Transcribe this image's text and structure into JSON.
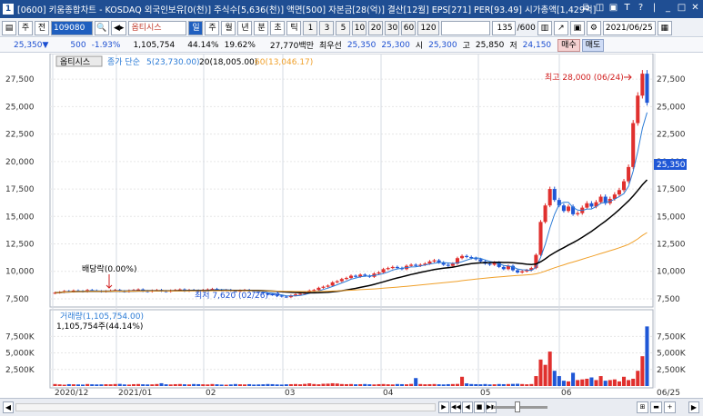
{
  "window": {
    "icon": "1",
    "title": "[0600] 키움종합차트 - KOSDAQ 외국인보유[0(천)] 주식수[5,636(천)] 액면[500] 자본금[28(억)] 결산[12월] EPS[271] PER[93.49] 시가총액[1,429억]",
    "buttons": [
      "⧉",
      "◫",
      "▣",
      "T",
      "?",
      "|",
      "_",
      "□",
      "✕"
    ]
  },
  "toolbar1": {
    "menu_icon": "▤",
    "type_label": "주",
    "all_label": "전",
    "code_value": "109080",
    "search_icon": "🔍",
    "arrow_label": "◀▸",
    "stock_name": "옵티시스",
    "periods": [
      "일",
      "주",
      "월",
      "년",
      "분",
      "초",
      "틱"
    ],
    "active_period": "일",
    "intervals": [
      "1",
      "3",
      "5",
      "10",
      "20",
      "30",
      "60",
      "120"
    ],
    "count_value": "135",
    "count_total": "/600",
    "date_value": "2021/06/25",
    "calendar_icon": "📅"
  },
  "quote": {
    "price": "25,350",
    "direction_icon": "▼",
    "change": "500",
    "change_pct": "-1.93%",
    "volume": "1,105,754",
    "vol_ratio": "44.14%",
    "turnover": "19.62%",
    "amount": "27,770백만",
    "bid_label": "최우선",
    "bid": "25,350",
    "ask": "25,300",
    "open_label": "시",
    "open": "25,300",
    "high_label": "고",
    "high": "25,850",
    "low_label": "저",
    "low": "24,150",
    "buy_label": "매수",
    "sell_label": "매도"
  },
  "chart_legend": {
    "name": "옵티시스",
    "ma_label": "종가 단순",
    "ma5": "5(23,730.00)",
    "ma20": "20(18,005.00)",
    "ma60": "60(13,046.17)",
    "high_label": "최고 28,000 (06/24)",
    "low_label": "최저 7,620 (02/26)",
    "dividend_label": "배당락(0.00%)",
    "volume_label": "거래량(1,105,754.00)",
    "volume_sub": "1,105,754주(44.14%)",
    "current_price_tag": "25,350"
  },
  "colors": {
    "up": "#e0302e",
    "down": "#1f57d6",
    "ma5": "#2b7bd6",
    "ma20": "#000000",
    "ma60": "#f0a02a",
    "grid": "#e6e6e6"
  },
  "chart_data": {
    "type": "candlestick",
    "x_labels": [
      "2020/12",
      "2021/01",
      "02",
      "03",
      "04",
      "05",
      "06",
      "06/25"
    ],
    "price_axis": [
      "27,500",
      "25,000",
      "22,500",
      "20,000",
      "17,500",
      "15,000",
      "12,500",
      "10,000",
      "7,500"
    ],
    "price_axis_values": [
      27500,
      25000,
      22500,
      20000,
      17500,
      15000,
      12500,
      10000,
      7500
    ],
    "price_range": [
      7000,
      29500
    ],
    "volume_axis": [
      "7,500K",
      "5,000K",
      "2,500K"
    ],
    "volume_axis_values": [
      7500,
      5000,
      2500
    ],
    "volume_range": [
      0,
      9600
    ],
    "closes": [
      8050,
      8100,
      8200,
      8150,
      8250,
      8200,
      8150,
      8300,
      8250,
      8200,
      8150,
      8200,
      8250,
      8300,
      8200,
      8150,
      8250,
      8300,
      8350,
      8200,
      8150,
      8250,
      8300,
      8200,
      8150,
      8250,
      8300,
      8350,
      8200,
      8300,
      8250,
      8200,
      8300,
      8350,
      8400,
      8300,
      8250,
      8300,
      8200,
      8150,
      8250,
      8300,
      8200,
      8150,
      8100,
      8000,
      7900,
      7850,
      7800,
      7700,
      7650,
      7800,
      7900,
      7950,
      8100,
      8250,
      8300,
      8500,
      8600,
      8700,
      9000,
      9100,
      9300,
      9400,
      9600,
      9500,
      9700,
      9600,
      9500,
      9800,
      9900,
      10200,
      10300,
      10400,
      10300,
      10200,
      10500,
      10600,
      10500,
      10600,
      10700,
      10900,
      11000,
      10800,
      10600,
      10500,
      10700,
      11200,
      11400,
      11300,
      11200,
      11100,
      10900,
      10700,
      10600,
      10800,
      10400,
      10200,
      10500,
      10100,
      9900,
      10000,
      10100,
      10300,
      11500,
      14500,
      16000,
      17500,
      16500,
      16000,
      15500,
      15900,
      15200,
      15300,
      15800,
      16200,
      15900,
      16300,
      16800,
      16200,
      16600,
      17000,
      17400,
      18200,
      19500,
      23500,
      26000,
      28000,
      25350
    ],
    "ma5": [
      23730
    ],
    "ma20": [
      18005
    ],
    "ma60": [
      13046.17
    ],
    "volumes_k": [
      300,
      250,
      200,
      280,
      260,
      240,
      220,
      300,
      260,
      240,
      250,
      270,
      260,
      300,
      320,
      240,
      220,
      280,
      300,
      260,
      240,
      250,
      300,
      420,
      260,
      240,
      280,
      300,
      260,
      240,
      300,
      280,
      260,
      240,
      300,
      260,
      220,
      200,
      240,
      300,
      260,
      240,
      280,
      220,
      240,
      260,
      300,
      280,
      240,
      220,
      260,
      280,
      300,
      260,
      320,
      400,
      300,
      260,
      340,
      360,
      420,
      380,
      300,
      280,
      300,
      260,
      280,
      300,
      260,
      240,
      280,
      300,
      260,
      240,
      300,
      280,
      260,
      320,
      1200,
      300,
      260,
      280,
      300,
      260,
      240,
      280,
      300,
      320,
      1400,
      400,
      300,
      280,
      260,
      300,
      240,
      260,
      300,
      280,
      300,
      320,
      340,
      300,
      260,
      300,
      1500,
      4000,
      3200,
      5200,
      2300,
      1500,
      800,
      700,
      2000,
      900,
      1000,
      1100,
      1300,
      900,
      1500,
      800,
      900,
      1000,
      700,
      1400,
      900,
      1100,
      2300,
      4500,
      9000,
      1105
    ]
  },
  "bottombar": {
    "scroll_left": "◀",
    "nav_buttons": [
      "▶",
      "◀◀",
      "◀",
      "■",
      "▶▶"
    ],
    "zoom_buttons": [
      "⊞",
      "▬",
      "+",
      "A"
    ],
    "scroll_right": "▶"
  }
}
